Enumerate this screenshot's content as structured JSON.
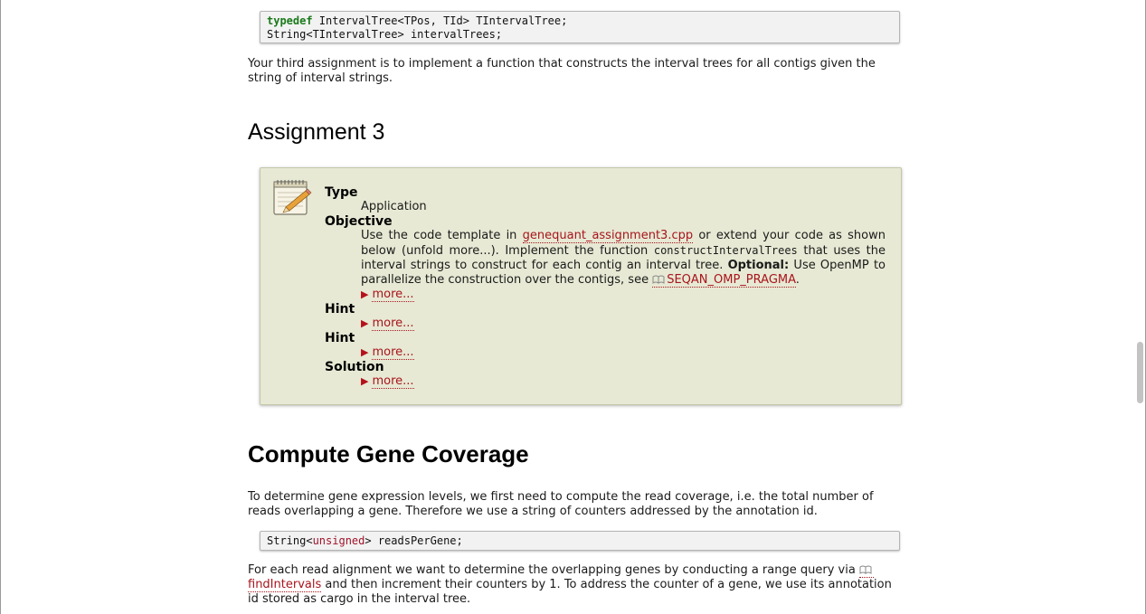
{
  "code1": {
    "line1_kw": "typedef",
    "line1_rest": " IntervalTree<TPos, TId> TIntervalTree;",
    "line2": "String<TIntervalTree> intervalTrees;"
  },
  "intro_text": "Your third assignment is to implement a function that constructs the interval trees for all contigs given the string of interval strings.",
  "assignment_heading": "Assignment 3",
  "assignment": {
    "type_label": "Type",
    "type_value": "Application",
    "objective_label": "Objective",
    "objective": {
      "part1": "Use the code template in ",
      "template_link": "genequant_assignment3.cpp",
      "part2": " or extend your code as shown below (unfold more...). Implement the function ",
      "func_code": "constructIntervalTrees",
      "part3": " that uses the interval strings to construct for each contig an interval tree. ",
      "optional_label": "Optional:",
      "part4": " Use OpenMP to parallelize the construction over the contigs, see ",
      "macro_link": "SEQAN_OMP_PRAGMA",
      "part5": "."
    },
    "hint1_label": "Hint",
    "hint2_label": "Hint",
    "solution_label": "Solution",
    "more_label": "more..."
  },
  "coverage_heading": "Compute Gene Coverage",
  "coverage_text": "To determine gene expression levels, we first need to compute the read coverage, i.e. the total number of reads overlapping a gene. Therefore we use a string of counters addressed by the annotation id.",
  "code2": {
    "prefix": "String<",
    "type": "unsigned",
    "suffix": "> readsPerGene;"
  },
  "final_text": {
    "part1": "For each read alignment we want to determine the overlapping genes by conducting a range query via ",
    "link": "findIntervals",
    "part2": " and then increment their counters by 1. To address the counter of a gene, we use its annotation id stored as cargo in the interval tree."
  }
}
